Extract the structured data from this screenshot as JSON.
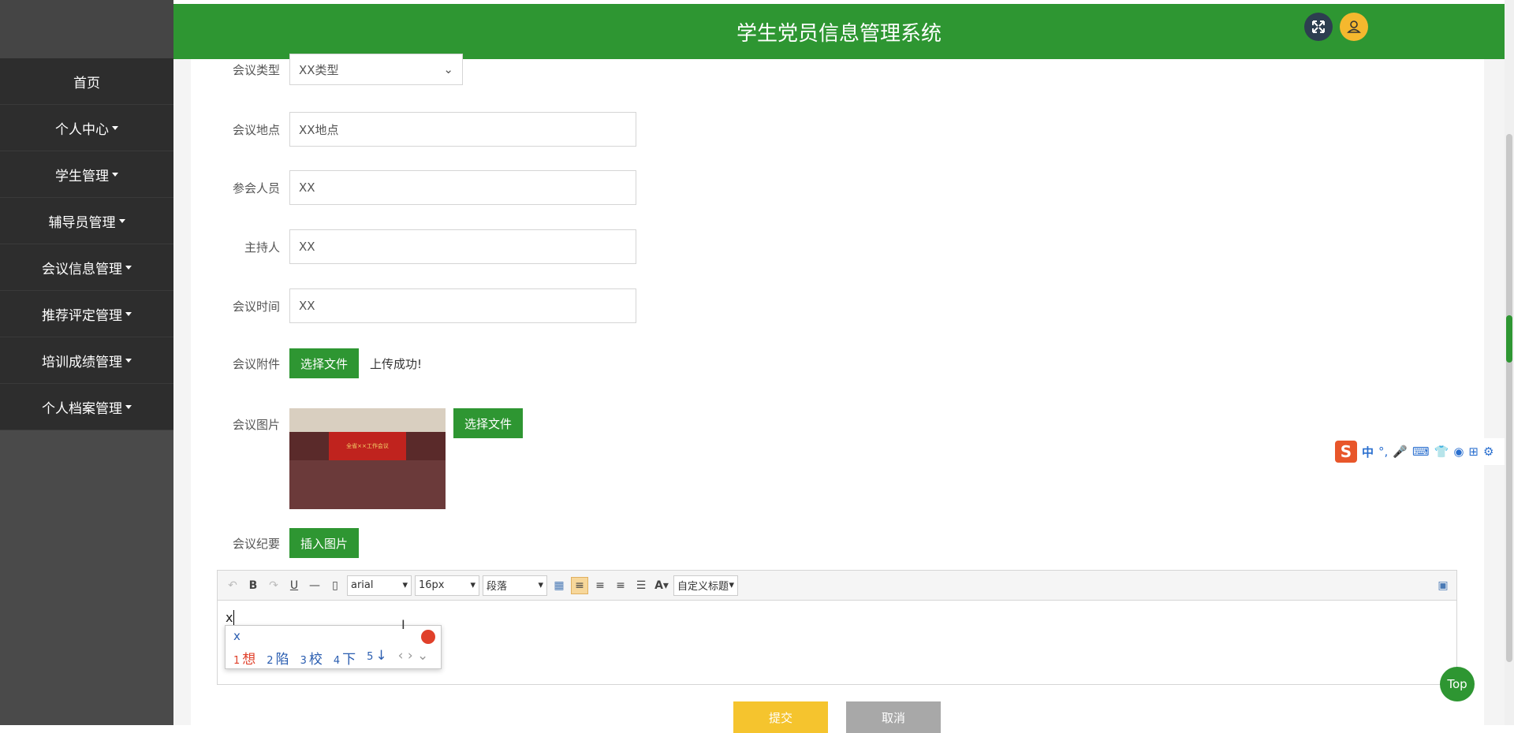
{
  "app": {
    "title": "学生党员信息管理系统"
  },
  "sidebar": {
    "items": [
      {
        "label": "首页"
      },
      {
        "label": "个人中心"
      },
      {
        "label": "学生管理"
      },
      {
        "label": "辅导员管理"
      },
      {
        "label": "会议信息管理"
      },
      {
        "label": "推荐评定管理"
      },
      {
        "label": "培训成绩管理"
      },
      {
        "label": "个人档案管理"
      }
    ]
  },
  "form": {
    "meeting_type": {
      "label": "会议类型",
      "value": "XX类型"
    },
    "meeting_place": {
      "label": "会议地点",
      "value": "XX地点"
    },
    "attendees": {
      "label": "参会人员",
      "value": "XX"
    },
    "host": {
      "label": "主持人",
      "value": "XX"
    },
    "meeting_time": {
      "label": "会议时间",
      "value": "XX"
    },
    "attachment": {
      "label": "会议附件",
      "button": "选择文件",
      "status": "上传成功!"
    },
    "image": {
      "label": "会议图片",
      "button": "选择文件",
      "banner_text": "全省××工作会议"
    },
    "minutes": {
      "label": "会议纪要",
      "button": "插入图片"
    }
  },
  "editor": {
    "font_family": "arial",
    "font_size": "16px",
    "paragraph": "段落",
    "custom_title": "自定义标题",
    "content": "x"
  },
  "ime": {
    "input": "x",
    "candidates": [
      {
        "num": "1",
        "text": "想"
      },
      {
        "num": "2",
        "text": "陷"
      },
      {
        "num": "3",
        "text": "校"
      },
      {
        "num": "4",
        "text": "下"
      },
      {
        "num": "5",
        "text": "↓"
      }
    ]
  },
  "buttons": {
    "submit": "提交",
    "cancel": "取消",
    "top": "Top"
  },
  "sogou": {
    "lang": "中"
  },
  "colors": {
    "primary": "#2e9632",
    "sidebar_bg": "#2d2d2d",
    "submit": "#f5c42e",
    "cancel": "#a8a8a8"
  }
}
